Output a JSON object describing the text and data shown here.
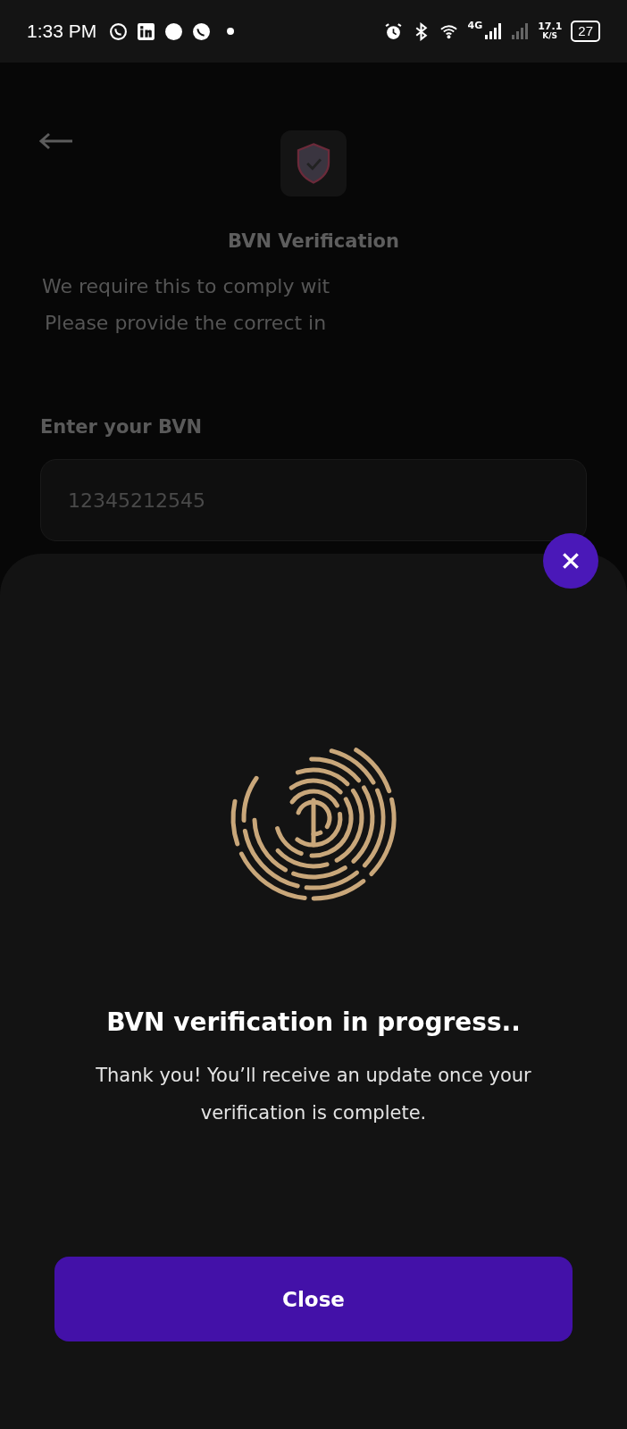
{
  "status_bar": {
    "time": "1:33 PM",
    "network": "4G",
    "speed": "17.1",
    "speed_unit": "K/S",
    "battery": "27"
  },
  "background_screen": {
    "title": "BVN Verification",
    "lines": [
      "We require this to comply wit",
      "Please provide the correct in"
    ],
    "field_label": "Enter your BVN",
    "field_value": "12345212545"
  },
  "sheet": {
    "heading": "BVN verification in progress..",
    "message": "Thank you! You’ll receive an update once your verification is complete.",
    "button": "Close"
  }
}
